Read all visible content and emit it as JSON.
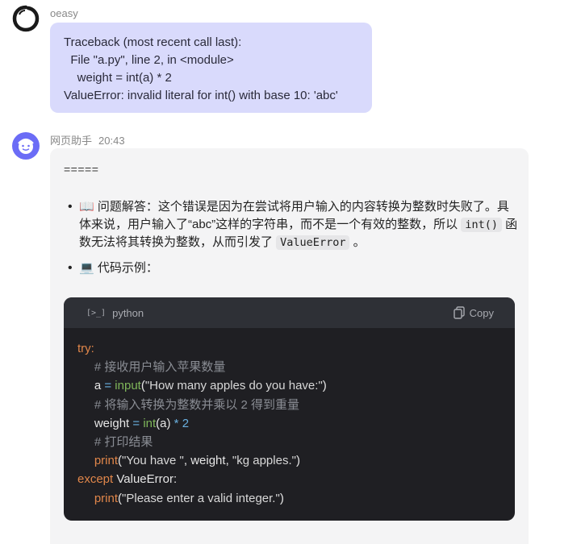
{
  "user": {
    "name": "oeasy",
    "traceback": [
      "Traceback (most recent call last):",
      "  File \"a.py\", line 2, in <module>",
      "    weight = int(a) * 2",
      "ValueError: invalid literal for int() with base 10: 'abc'"
    ]
  },
  "bot": {
    "name": "网页助手",
    "time": "20:43",
    "separator": "=====",
    "bullet1": {
      "emoji": "📖",
      "pre": " 问题解答：这个错误是因为在尝试将用户输入的内容转换为整数时失败了。具体来说，用户输入了“abc”这样的字符串，而不是一个有效的整数，所以 ",
      "code1": "int()",
      "mid": " 函数无法将其转换为整数，从而引发了 ",
      "code2": "ValueError",
      "post": " 。"
    },
    "bullet2": {
      "emoji": "💻",
      "text": " 代码示例："
    },
    "code": {
      "language": "python",
      "copy_label": "Copy",
      "lines": {
        "l1": "try:",
        "l2": "# 接收用户输入苹果数量",
        "l3_a": "a",
        "l3_eq": "=",
        "l3_fn": "input",
        "l3_str": "\"How many apples do you have:\"",
        "l4": "# 将输入转换为整数并乘以 2 得到重量",
        "l5_a": "weight",
        "l5_eq": "=",
        "l5_fn": "int",
        "l5_arg": "a",
        "l5_op": "*",
        "l5_num": "2",
        "l6": "# 打印结果",
        "l7_fn": "print",
        "l7_s1": "\"You have \"",
        "l7_v": "weight",
        "l7_s2": "\"kg apples.\"",
        "l8_kw": "except",
        "l8_ex": "ValueError",
        "l9_fn": "print",
        "l9_s": "\"Please enter a valid integer.\""
      }
    }
  }
}
